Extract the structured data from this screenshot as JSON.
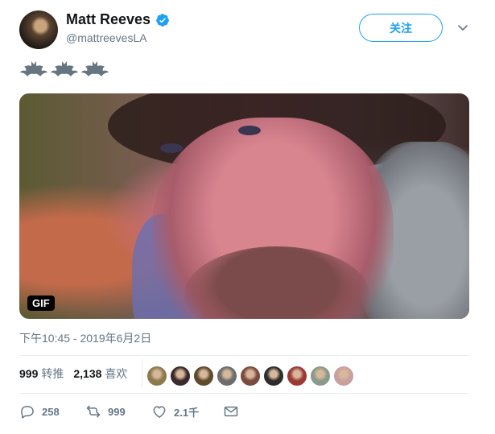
{
  "author": {
    "display_name": "Matt Reeves",
    "handle": "@mattreevesLA",
    "verified_icon": "verified-badge-icon"
  },
  "follow_label": "关注",
  "tweet": {
    "emojis": [
      "bat",
      "bat",
      "bat"
    ],
    "media_badge": "GIF",
    "timestamp": "下午10:45 - 2019年6月2日"
  },
  "stats": {
    "retweets_count": "999",
    "retweets_label": "转推",
    "likes_count": "2,138",
    "likes_label": "喜欢"
  },
  "actions": {
    "reply_count": "258",
    "retweet_count": "999",
    "like_count": "2.1千"
  },
  "colors": {
    "accent": "#1da1f2",
    "muted": "#657786",
    "text": "#14171a",
    "divider": "#e6ecf0"
  },
  "liker_avatars": [
    "#8c7a4f",
    "#3a2a2a",
    "#5e4b2e",
    "#6d6d6d",
    "#7a4b3f",
    "#2d2d2d",
    "#9b3a34",
    "#8a9a8a",
    "#c9a0a0"
  ]
}
